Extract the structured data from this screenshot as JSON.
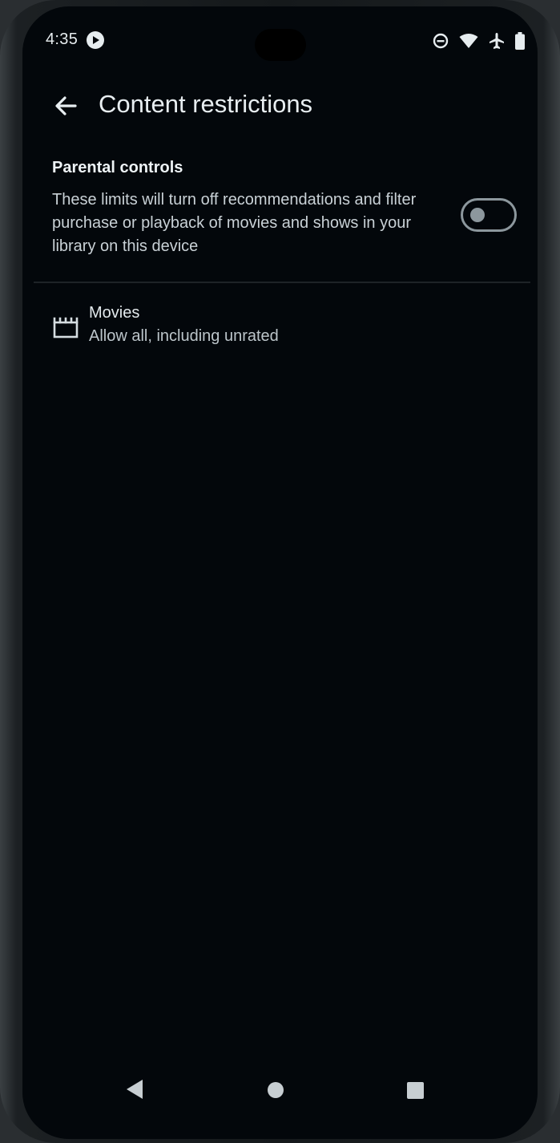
{
  "status_bar": {
    "time": "4:35",
    "icons": [
      "media-app-icon",
      "do-not-disturb-icon",
      "wifi-icon",
      "airplane-mode-icon",
      "battery-icon"
    ]
  },
  "header": {
    "title": "Content restrictions",
    "back_icon": "arrow-back-icon"
  },
  "parental_controls": {
    "title": "Parental controls",
    "description": "These limits will turn off recommendations and filter purchase or playback of movies and shows in your library on this device",
    "enabled": false
  },
  "items": [
    {
      "icon": "movie-clapper-icon",
      "title": "Movies",
      "subtitle": "Allow all, including unrated"
    }
  ],
  "nav_bar": {
    "buttons": [
      "nav-back-icon",
      "nav-home-icon",
      "nav-recents-icon"
    ]
  },
  "colors": {
    "background": "#03070b",
    "text_primary": "#e8eef1",
    "text_secondary": "#c9d1d6",
    "toggle_off": "#8c979d"
  }
}
